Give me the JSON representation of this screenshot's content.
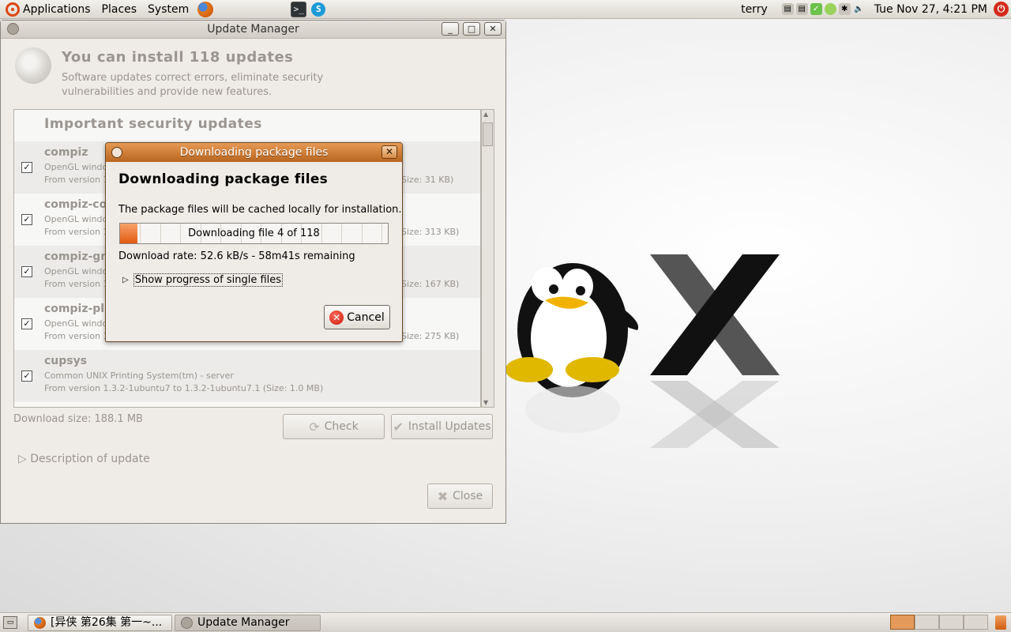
{
  "top_panel": {
    "menus": [
      "Applications",
      "Places",
      "System"
    ],
    "user": "terry",
    "clock": "Tue Nov 27,  4:21 PM"
  },
  "update_manager": {
    "title": "Update Manager",
    "heading": "You can install 118 updates",
    "subtext": "Software updates correct errors, eliminate security vulnerabilities and provide new features.",
    "section_title": "Important security updates",
    "rows": [
      {
        "name": "compiz",
        "desc": "OpenGL windo",
        "version": "From version 1",
        "size_tail": "Size: 31 KB)"
      },
      {
        "name": "compiz-co",
        "desc": "OpenGL windo",
        "version": "From version 1",
        "size_tail": "Size: 313 KB)"
      },
      {
        "name": "compiz-gn",
        "desc": "OpenGL windo",
        "version": "From version 1",
        "size_tail": "Size: 167 KB)"
      },
      {
        "name": "compiz-pl",
        "desc": "OpenGL windo",
        "version": "From version 1",
        "size_tail": "Size: 275 KB)"
      },
      {
        "name": "cupsys",
        "desc": "Common UNIX Printing System(tm) - server",
        "version": "From version 1.3.2-1ubuntu7 to 1.3.2-1ubuntu7.1 (Size: 1.0 MB)",
        "size_tail": ""
      }
    ],
    "download_size": "Download size: 188.1 MB",
    "check_label": "Check",
    "install_label": "Install Updates",
    "close_label": "Close",
    "description_label": "Description of update"
  },
  "download_dialog": {
    "title": "Downloading package files",
    "heading": "Downloading package files",
    "info": "The package files will be cached locally for installation.",
    "progress_text": "Downloading file 4 of 118",
    "progress_fraction": 0.065,
    "rate": "Download rate: 52.6 kB/s - 58m41s remaining",
    "expander_label": "Show progress of single files",
    "cancel_label": "Cancel"
  },
  "taskbar": {
    "tasks": [
      {
        "label": "[异侠 第26集 第一~..."
      },
      {
        "label": "Update Manager"
      }
    ]
  }
}
